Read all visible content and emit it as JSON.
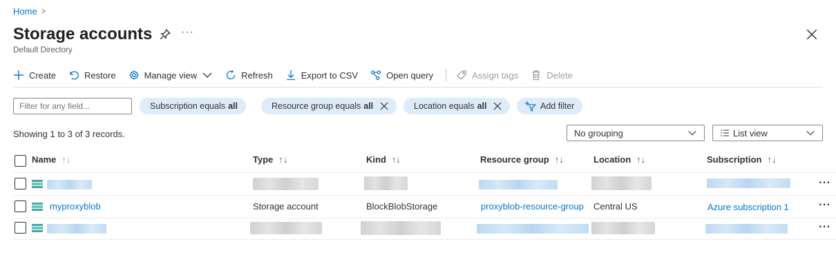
{
  "breadcrumb": {
    "home": "Home",
    "chevron": ">"
  },
  "header": {
    "title": "Storage accounts",
    "subtitle": "Default Directory",
    "more": "···"
  },
  "toolbar": {
    "create": "Create",
    "restore": "Restore",
    "manage_view": "Manage view",
    "refresh": "Refresh",
    "export": "Export to CSV",
    "open_query": "Open query",
    "assign_tags": "Assign tags",
    "delete": "Delete"
  },
  "filters": {
    "placeholder": "Filter for any field...",
    "subscription": {
      "label": "Subscription equals",
      "value": "all"
    },
    "resource_group": {
      "label": "Resource group equals",
      "value": "all"
    },
    "location": {
      "label": "Location equals",
      "value": "all"
    },
    "add_filter": "Add filter"
  },
  "records_text": "Showing 1 to 3 of 3 records.",
  "grouping": "No grouping",
  "view": "List view",
  "columns": {
    "name": "Name",
    "type": "Type",
    "kind": "Kind",
    "resource_group": "Resource group",
    "location": "Location",
    "subscription": "Subscription",
    "sort_glyph": "↑↓"
  },
  "rows": [
    {
      "name": "",
      "type": "",
      "kind": "",
      "resource_group": "",
      "location": "",
      "subscription": "",
      "redacted": true
    },
    {
      "name": "myproxyblob",
      "type": "Storage account",
      "kind": "BlockBlobStorage",
      "resource_group": "proxyblob-resource-group",
      "location": "Central US",
      "subscription": "Azure subscription 1",
      "redacted": false
    },
    {
      "name": "",
      "type": "",
      "kind": "",
      "resource_group": "",
      "location": "",
      "subscription": "",
      "redacted": true
    }
  ],
  "row_more": "···",
  "colors": {
    "accent": "#0078d4",
    "pill": "#deecf9",
    "storage_icon": "#40a9a1"
  }
}
